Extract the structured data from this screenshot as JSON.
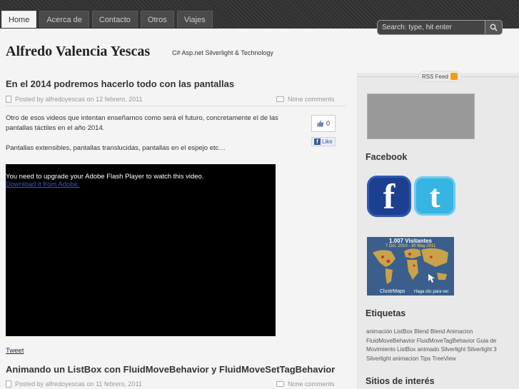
{
  "nav": {
    "tabs": [
      {
        "label": "Home",
        "active": true
      },
      {
        "label": "Acerca de"
      },
      {
        "label": "Contacto"
      },
      {
        "label": "Otros"
      },
      {
        "label": "Viajes"
      }
    ]
  },
  "search": {
    "placeholder": "Search: type, hit enter",
    "icon": "magnifier-icon"
  },
  "header": {
    "title": "Alfredo Valencia Yescas",
    "description": "C# Asp.net Silverlight & Technology"
  },
  "posts": [
    {
      "title": "En el 2014 podremos hacerlo todo con las pantallas",
      "meta": "Posted by alfredoyescas on 12 febrero, 2011",
      "comments": "None comments",
      "para1": "Otro de esos videos que intentan enseñarnos como será el futuro, concretamente el de las pantallas táctiles en el año 2014.",
      "para2": "Pantallas extensibles, pantallas translucidas, pantallas en el espejo etc…",
      "like_count": "0",
      "like_label": "Like",
      "video_message": "You need to upgrade your Adobe Flash Player to watch this video.",
      "video_link": "Download it from Adobe.",
      "tweet": "Tweet"
    },
    {
      "title": "Animando un ListBox con FluidMoveBehavior y FluidMoveSetTagBehavior",
      "meta": "Posted by alfredoyescas on 11 febrero, 2011",
      "comments": "None comments"
    }
  ],
  "sidebar": {
    "rss_label": "RSS Feed",
    "facebook_heading": "Facebook",
    "facebook_logo": "f",
    "twitter_logo": "t",
    "map_visits": "1.007  Visitantes",
    "map_dates": "7 Oct. 2010 - 30 May 2011",
    "map_brand": "ClustrMaps",
    "map_cta": "Haga clic para ver",
    "tags_heading": "Etiquetas",
    "tags": "animación ListBox Blend Blend Animacion FluidMoveBehavior FluidMoveTagBehavior Guia de Movimiento ListBox animado Silverlight Silverlight 3 Silverlight animacion Tips TreeView",
    "sites_heading": "Sitios de interés"
  },
  "colors": {
    "accent_link": "#3355cc",
    "facebook": "#3b5998",
    "twitter": "#36b4e4",
    "rss": "#f39c12"
  }
}
